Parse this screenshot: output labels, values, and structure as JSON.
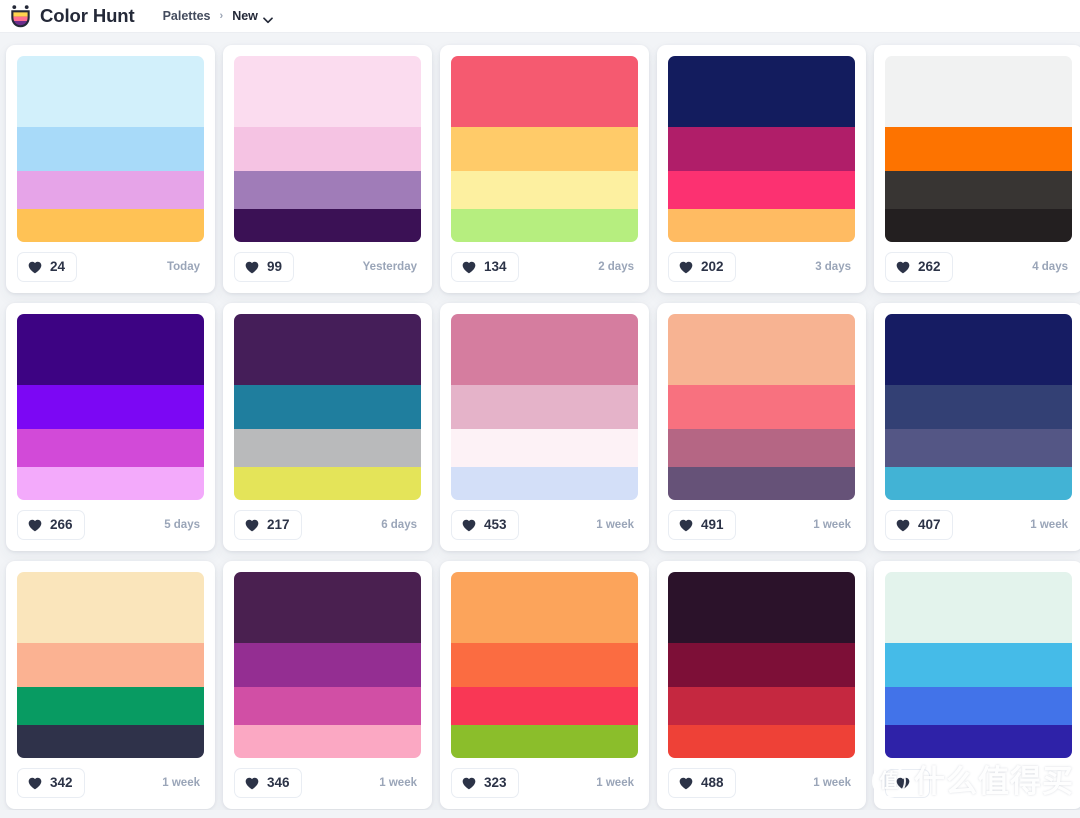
{
  "header": {
    "logo_icon": "shield-palette-logo",
    "brand_name": "Color Hunt",
    "breadcrumb": {
      "parent": "Palettes",
      "separator": "›",
      "current": "New",
      "chevron_icon": "chevron-down-icon"
    }
  },
  "theme": {
    "page_background": "#f2f4f7",
    "card_background": "#ffffff",
    "text_primary": "#242938",
    "text_muted": "#9aa5b8",
    "border": "#e9edf3"
  },
  "like_icon": "heart-icon",
  "palettes": [
    {
      "likes": "24",
      "age": "Today",
      "colors": [
        "#d2f0fb",
        "#a8daf9",
        "#e6a4e8",
        "#ffc255"
      ]
    },
    {
      "likes": "99",
      "age": "Yesterday",
      "colors": [
        "#fbdcef",
        "#f5c3e3",
        "#a07cb8",
        "#3b1155"
      ]
    },
    {
      "likes": "134",
      "age": "2 days",
      "colors": [
        "#f55a70",
        "#ffcb69",
        "#fdf0a0",
        "#b6ee7f"
      ]
    },
    {
      "likes": "202",
      "age": "3 days",
      "colors": [
        "#131c5e",
        "#b01e69",
        "#fc3171",
        "#ffbb62"
      ]
    },
    {
      "likes": "262",
      "age": "4 days",
      "colors": [
        "#f1f2f2",
        "#fd7300",
        "#383533",
        "#231f20"
      ]
    },
    {
      "likes": "266",
      "age": "5 days",
      "colors": [
        "#3d0383",
        "#7c07f4",
        "#d24ad8",
        "#f3aafb"
      ]
    },
    {
      "likes": "217",
      "age": "6 days",
      "colors": [
        "#451e59",
        "#1f7e9e",
        "#b9babb",
        "#e4e459"
      ]
    },
    {
      "likes": "453",
      "age": "1 week",
      "colors": [
        "#d57d9f",
        "#e5b3c9",
        "#fdf2f6",
        "#d3dff8"
      ]
    },
    {
      "likes": "491",
      "age": "1 week",
      "colors": [
        "#f7b392",
        "#f8717f",
        "#b56684",
        "#665278"
      ]
    },
    {
      "likes": "407",
      "age": "1 week",
      "colors": [
        "#161c63",
        "#334074",
        "#545685",
        "#42b3d5"
      ]
    },
    {
      "likes": "342",
      "age": "1 week",
      "colors": [
        "#fae5bb",
        "#fbb292",
        "#089b62",
        "#2f324a"
      ]
    },
    {
      "likes": "346",
      "age": "1 week",
      "colors": [
        "#4a2050",
        "#942e92",
        "#d14fa5",
        "#fba8c3"
      ]
    },
    {
      "likes": "323",
      "age": "1 week",
      "colors": [
        "#fca45b",
        "#fb6c41",
        "#f93755",
        "#8bbe2b"
      ]
    },
    {
      "likes": "488",
      "age": "1 week",
      "colors": [
        "#2b122a",
        "#7d0f37",
        "#c52840",
        "#ee4137"
      ]
    },
    {
      "likes": "",
      "age": "",
      "colors": [
        "#e3f3ec",
        "#45bbe8",
        "#4273e9",
        "#2e22a8"
      ]
    }
  ],
  "watermark": {
    "badge_text": "值",
    "text": "什么值得买"
  }
}
